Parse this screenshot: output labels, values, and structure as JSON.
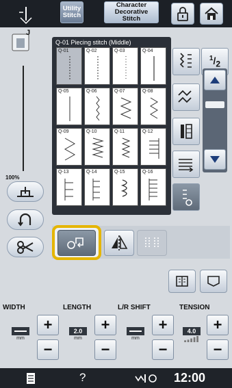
{
  "topbar": {
    "tab_utility": "Utility\nStitch",
    "tab_character": "Character\nDecorative\nStitch",
    "icons": [
      "presser-foot-icon",
      "lock-icon",
      "home-icon"
    ]
  },
  "left": {
    "foot_letter": "J",
    "speed_label": "100%",
    "icons": [
      "needle-position-icon",
      "reverse-stitch-icon",
      "thread-cutter-icon"
    ]
  },
  "panel": {
    "title": "Q-01  Piecing stitch (Middle)",
    "stitches": [
      {
        "code": "Q-01",
        "selected": true
      },
      {
        "code": "Q-02",
        "selected": false
      },
      {
        "code": "Q-03",
        "selected": false
      },
      {
        "code": "Q-04",
        "selected": false
      },
      {
        "code": "Q-05",
        "selected": false
      },
      {
        "code": "Q-06",
        "selected": false
      },
      {
        "code": "Q-07",
        "selected": false
      },
      {
        "code": "Q-08",
        "selected": false
      },
      {
        "code": "Q-09",
        "selected": false
      },
      {
        "code": "Q-10",
        "selected": false
      },
      {
        "code": "Q-11",
        "selected": false
      },
      {
        "code": "Q-12",
        "selected": false
      },
      {
        "code": "Q-13",
        "selected": false
      },
      {
        "code": "Q-14",
        "selected": false
      },
      {
        "code": "Q-15",
        "selected": false
      },
      {
        "code": "Q-16",
        "selected": false
      }
    ]
  },
  "side": {
    "page_fraction": "1/2",
    "page_numerator": "1",
    "page_denominator": "2"
  },
  "settings": {
    "width": {
      "label": "WIDTH",
      "value": "",
      "unit": "mm"
    },
    "length": {
      "label": "LENGTH",
      "value": "2.0",
      "unit": "mm"
    },
    "lr_shift": {
      "label": "L/R SHIFT",
      "value": "",
      "unit": "mm"
    },
    "tension": {
      "label": "TENSION",
      "value": "4.0"
    }
  },
  "status": {
    "time": "12:00",
    "help": "?"
  },
  "colors": {
    "highlight": "#e5b500",
    "panel_bg": "#2b3038",
    "topbar_bg": "#1c2026"
  }
}
